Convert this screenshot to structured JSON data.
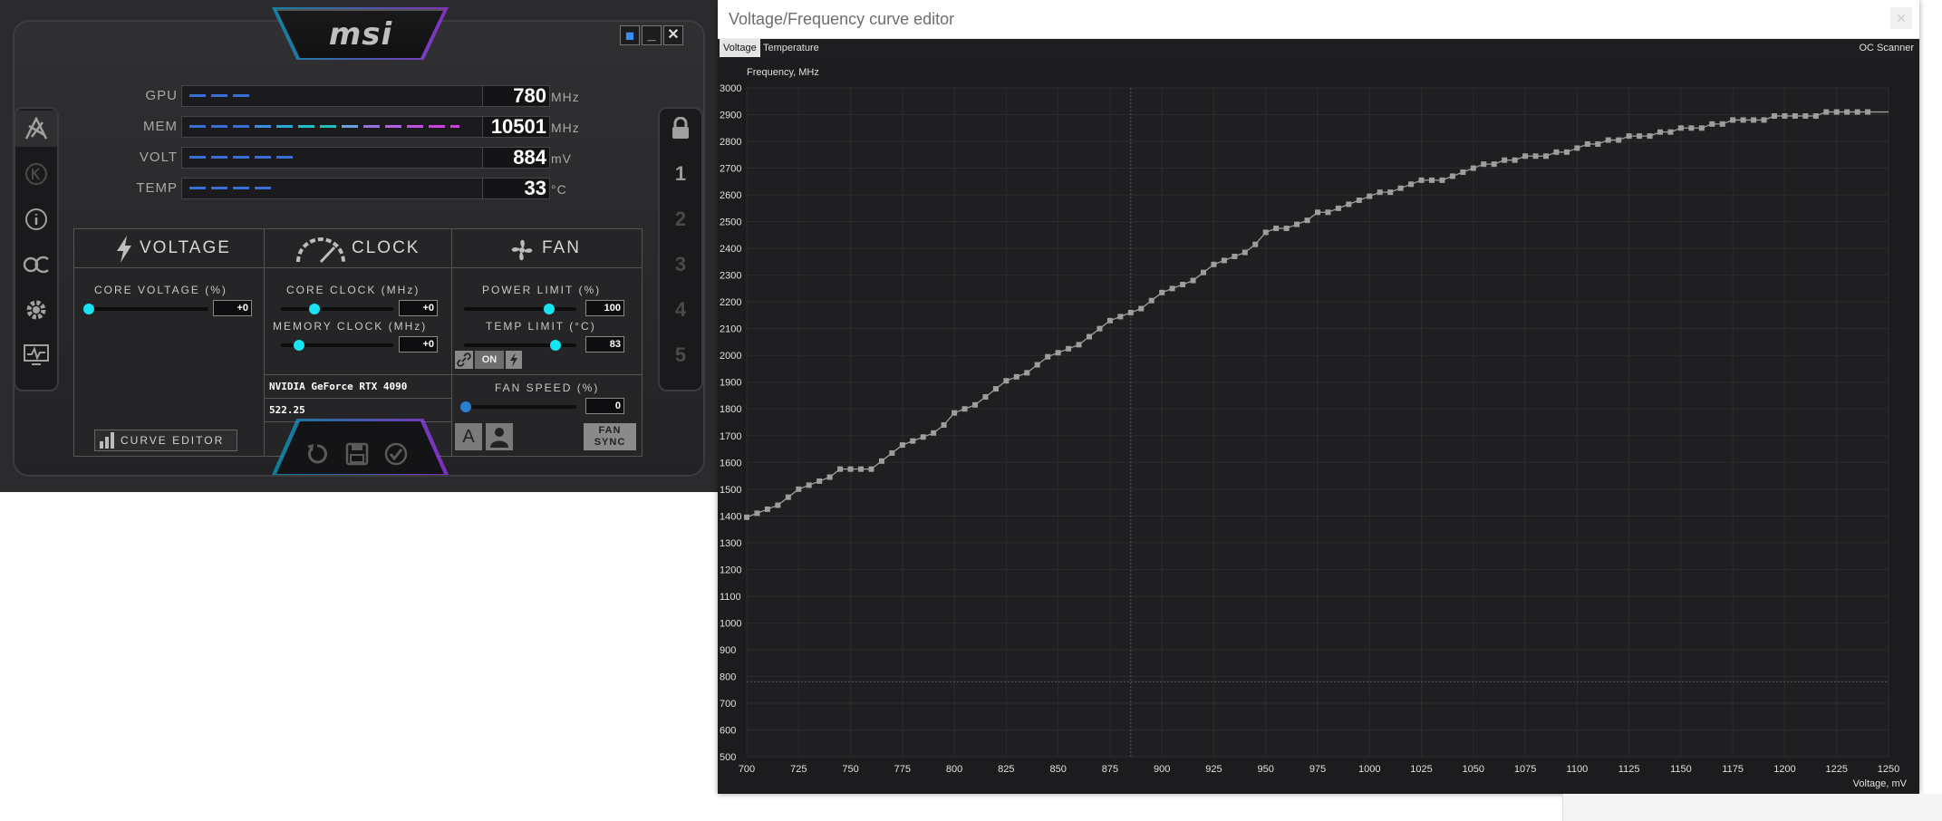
{
  "afterburner": {
    "logo": "msi",
    "window_buttons": [
      "◼",
      "_",
      "✕"
    ],
    "sidebar_left": [
      {
        "icon": "afterburner-icon"
      },
      {
        "icon": "k-boost-icon"
      },
      {
        "icon": "info-icon"
      },
      {
        "icon": "oc-scanner-icon"
      },
      {
        "icon": "settings-gear-icon"
      },
      {
        "icon": "monitor-icon"
      }
    ],
    "sidebar_right": [
      {
        "icon": "lock-icon"
      },
      {
        "label": "1"
      },
      {
        "label": "2"
      },
      {
        "label": "3"
      },
      {
        "label": "4"
      },
      {
        "label": "5"
      }
    ],
    "meters": [
      {
        "label": "GPU",
        "value": "780",
        "unit": "MHz",
        "fill": 0.25
      },
      {
        "label": "MEM",
        "value": "10501",
        "unit": "MHz",
        "fill": 0.98
      },
      {
        "label": "VOLT",
        "value": "884",
        "unit": "mV",
        "fill": 0.36
      },
      {
        "label": "TEMP",
        "value": "33",
        "unit": "°C",
        "fill": 0.28
      }
    ],
    "voltage": {
      "title": "VOLTAGE",
      "core_voltage_label": "CORE VOLTAGE (%)",
      "core_voltage_value": "+0",
      "curve_editor_label": "CURVE EDITOR"
    },
    "clock": {
      "title": "CLOCK",
      "core_clock_label": "CORE CLOCK (MHz)",
      "core_clock_value": "+0",
      "memory_clock_label": "MEMORY CLOCK (MHz)",
      "memory_clock_value": "+0",
      "gpu_name": "NVIDIA GeForce RTX 4090",
      "driver": "522.25"
    },
    "fan": {
      "title": "FAN",
      "power_limit_label": "POWER LIMIT (%)",
      "power_limit_value": "100",
      "temp_limit_label": "TEMP LIMIT (°C)",
      "temp_limit_value": "83",
      "link_on_label": "ON",
      "fan_speed_label": "FAN SPEED (%)",
      "fan_speed_value": "0",
      "auto_label": "A",
      "fan_sync_label": "FAN SYNC"
    }
  },
  "curve_editor": {
    "title": "Voltage/Frequency curve editor",
    "close_label": "✕",
    "tabs": [
      "Voltage",
      "Temperature"
    ],
    "oc_scanner": "OC Scanner",
    "colors": {
      "background": "#1c1c1e",
      "grid": "#2c2c2e",
      "curve": "#9e9e9e",
      "text": "#e0e0e0"
    },
    "chart_data": {
      "type": "line",
      "ylabel": "Frequency, MHz",
      "xlabel": "Voltage, mV",
      "xlim": [
        700,
        1250
      ],
      "ylim": [
        500,
        3000
      ],
      "xticks": [
        700,
        725,
        750,
        775,
        800,
        825,
        850,
        875,
        900,
        925,
        950,
        975,
        1000,
        1025,
        1050,
        1075,
        1100,
        1125,
        1150,
        1175,
        1200,
        1225,
        1250
      ],
      "yticks": [
        500,
        600,
        700,
        800,
        900,
        1000,
        1100,
        1200,
        1300,
        1400,
        1500,
        1600,
        1700,
        1800,
        1900,
        2000,
        2100,
        2200,
        2300,
        2400,
        2500,
        2600,
        2700,
        2800,
        2900,
        3000
      ],
      "current_voltage_marker": 885,
      "idle_frequency_marker": 780,
      "grid": true,
      "series": [
        {
          "x": [
            700,
            705,
            710,
            715,
            720,
            725,
            730,
            735,
            740,
            745,
            750,
            755,
            760,
            765,
            770,
            775,
            780,
            785,
            790,
            795,
            800,
            805,
            810,
            815,
            820,
            825,
            830,
            835,
            840,
            845,
            850,
            855,
            860,
            865,
            870,
            875,
            880,
            885,
            890,
            895,
            900,
            905,
            910,
            915,
            920,
            925,
            930,
            935,
            940,
            945,
            950,
            955,
            960,
            965,
            970,
            975,
            980,
            985,
            990,
            995,
            1000,
            1005,
            1010,
            1015,
            1020,
            1025,
            1030,
            1035,
            1040,
            1045,
            1050,
            1055,
            1060,
            1065,
            1070,
            1075,
            1080,
            1085,
            1090,
            1095,
            1100,
            1105,
            1110,
            1115,
            1120,
            1125,
            1130,
            1135,
            1140,
            1145,
            1150,
            1155,
            1160,
            1165,
            1170,
            1175,
            1180,
            1185,
            1190,
            1195,
            1200,
            1205,
            1210,
            1215,
            1220,
            1225,
            1230,
            1235,
            1240,
            1250
          ],
          "y": [
            1395,
            1410,
            1425,
            1440,
            1470,
            1500,
            1515,
            1530,
            1545,
            1575,
            1575,
            1575,
            1575,
            1605,
            1635,
            1665,
            1680,
            1695,
            1710,
            1740,
            1785,
            1800,
            1815,
            1845,
            1875,
            1905,
            1920,
            1935,
            1965,
            1995,
            2010,
            2025,
            2040,
            2070,
            2100,
            2130,
            2145,
            2160,
            2175,
            2205,
            2235,
            2250,
            2265,
            2280,
            2310,
            2340,
            2355,
            2370,
            2385,
            2415,
            2460,
            2475,
            2475,
            2490,
            2505,
            2535,
            2535,
            2550,
            2565,
            2580,
            2595,
            2610,
            2610,
            2625,
            2640,
            2655,
            2655,
            2655,
            2670,
            2685,
            2700,
            2715,
            2715,
            2730,
            2730,
            2745,
            2745,
            2745,
            2760,
            2760,
            2775,
            2790,
            2790,
            2805,
            2805,
            2820,
            2820,
            2820,
            2835,
            2835,
            2850,
            2850,
            2850,
            2865,
            2865,
            2880,
            2880,
            2880,
            2880,
            2895,
            2895,
            2895,
            2895,
            2895,
            2910,
            2910,
            2910,
            2910,
            2910,
            2910
          ]
        }
      ]
    }
  }
}
